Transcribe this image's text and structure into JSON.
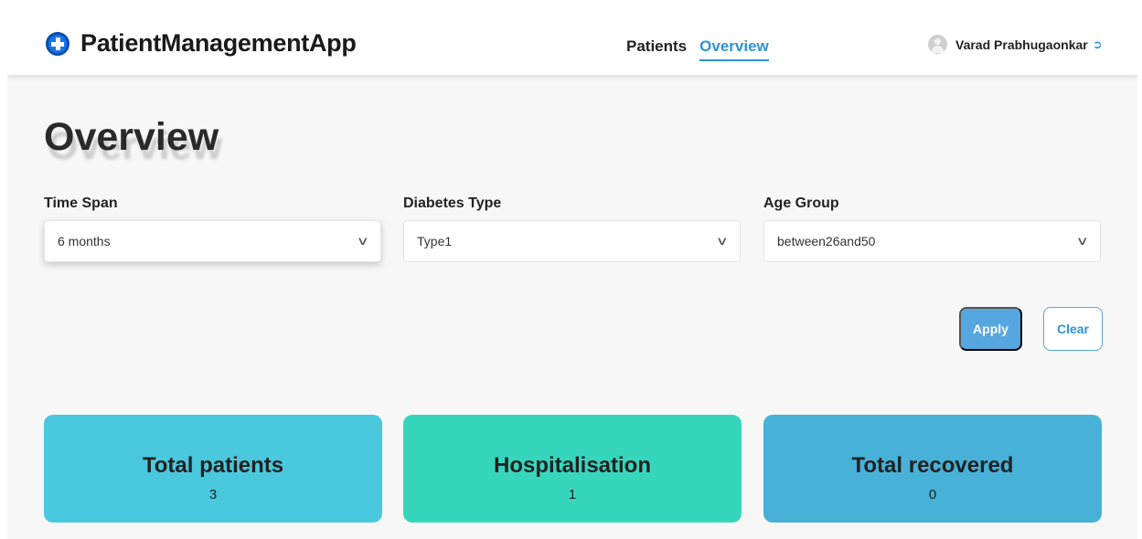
{
  "brand": {
    "name": "PatientManagementApp",
    "icon": "medical-cross-icon",
    "color": "#1a73e8"
  },
  "nav": {
    "items": [
      {
        "label": "Patients"
      },
      {
        "label": "Overview",
        "active": true
      }
    ]
  },
  "user": {
    "name": "Varad Prabhugaonkar",
    "avatar_icon": "user-avatar-icon",
    "logout_icon": "logout-icon"
  },
  "page": {
    "title": "Overview"
  },
  "filters": [
    {
      "label": "Time Span",
      "value": "6 months"
    },
    {
      "label": "Diabetes Type",
      "value": "Type1"
    },
    {
      "label": "Age Group",
      "value": "between26and50"
    }
  ],
  "actions": {
    "apply": "Apply",
    "clear": "Clear"
  },
  "cards": [
    {
      "title": "Total patients",
      "value": "3",
      "color": "#4ac8dd"
    },
    {
      "title": "Hospitalisation",
      "value": "1",
      "color": "#36d6bd"
    },
    {
      "title": "Total recovered",
      "value": "0",
      "color": "#47b1d8"
    }
  ],
  "colors": {
    "accent": "#2b94d6",
    "apply_button": "#56a7e0"
  }
}
